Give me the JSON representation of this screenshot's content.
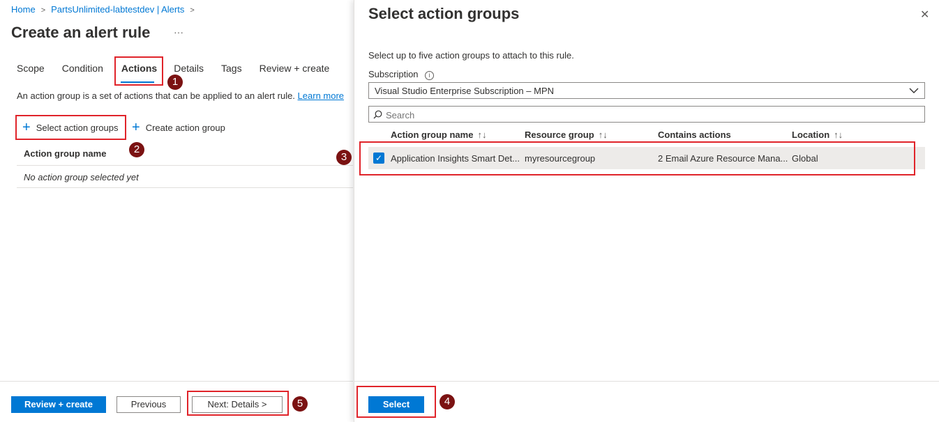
{
  "breadcrumb": {
    "home": "Home",
    "resource": "PartsUnlimited-labtestdev | Alerts"
  },
  "page": {
    "title": "Create an alert rule",
    "more": "···"
  },
  "tabs": [
    "Scope",
    "Condition",
    "Actions",
    "Details",
    "Tags",
    "Review + create"
  ],
  "actions": {
    "description": "An action group is a set of actions that can be applied to an alert rule.",
    "learn_more": "Learn more",
    "select_btn": "Select action groups",
    "create_btn": "Create action group",
    "col_name": "Action group name",
    "empty": "No action group selected yet"
  },
  "footer": {
    "review": "Review + create",
    "previous": "Previous",
    "next": "Next: Details >"
  },
  "panel": {
    "title": "Select action groups",
    "close": "✕",
    "subtitle": "Select up to five action groups to attach to this rule.",
    "subscription_label": "Subscription",
    "subscription_value": "Visual Studio Enterprise Subscription – MPN",
    "search_placeholder": "Search",
    "columns": [
      "Action group name",
      "Resource group",
      "Contains actions",
      "Location"
    ],
    "rows": [
      {
        "name": "Application Insights Smart Det...",
        "resource_group": "myresourcegroup",
        "actions": "2 Email Azure Resource Mana...",
        "location": "Global",
        "checked": true
      }
    ],
    "select_btn": "Select"
  },
  "badges": [
    "1",
    "2",
    "3",
    "4",
    "5"
  ],
  "colors": {
    "accent": "#0078d4",
    "highlight": "#e0242a",
    "badge": "#7b1212"
  }
}
